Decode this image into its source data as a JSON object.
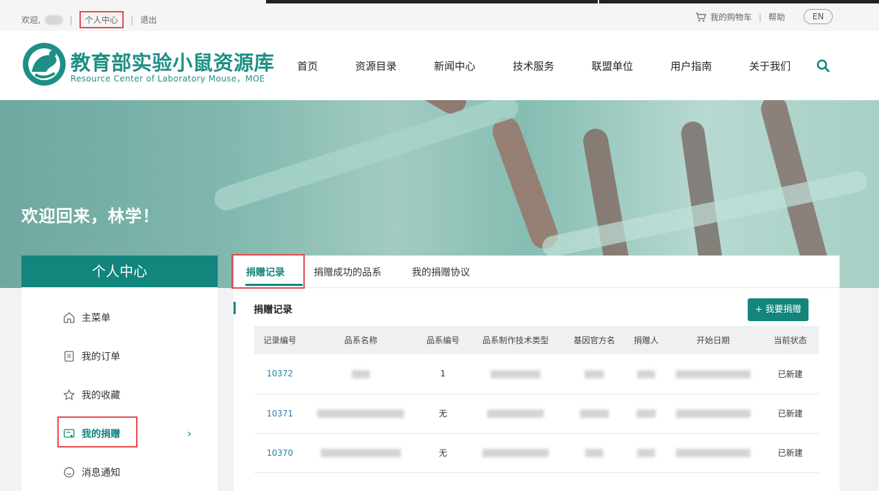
{
  "topbar": {
    "welcome": "欢迎,",
    "personal_center": "个人中心",
    "logout": "退出",
    "cart": "我的购物车",
    "help": "帮助",
    "lang": "EN"
  },
  "brand": {
    "name_cn": "教育部实验小鼠资源库",
    "name_en": "Resource Center of Laboratory Mouse，MOE",
    "color": "#12857c"
  },
  "nav": {
    "items": [
      "首页",
      "资源目录",
      "新闻中心",
      "技术服务",
      "联盟单位",
      "用户指南",
      "关于我们"
    ]
  },
  "banner": {
    "welcome": "欢迎回来，林学！"
  },
  "sidebar": {
    "title": "个人中心",
    "items": [
      {
        "label": "主菜单",
        "icon": "home-icon"
      },
      {
        "label": "我的订单",
        "icon": "document-icon"
      },
      {
        "label": "我的收藏",
        "icon": "star-icon"
      },
      {
        "label": "我的捐赠",
        "icon": "donation-icon",
        "active": true
      },
      {
        "label": "消息通知",
        "icon": "message-icon"
      }
    ]
  },
  "tabs": [
    "捐赠记录",
    "捐赠成功的品系",
    "我的捐赠协议"
  ],
  "section": {
    "title": "捐赠记录",
    "donate_button": "+ 我要捐赠"
  },
  "table": {
    "headers": [
      "记录编号",
      "品系名称",
      "品系编号",
      "品系制作技术类型",
      "基因官方名",
      "捐赠人",
      "开始日期",
      "当前状态"
    ],
    "rows": [
      {
        "id": "10372",
        "strain_no": "1",
        "status": "已新建"
      },
      {
        "id": "10371",
        "strain_no": "无",
        "status": "已新建"
      },
      {
        "id": "10370",
        "strain_no": "无",
        "status": "已新建"
      }
    ]
  }
}
